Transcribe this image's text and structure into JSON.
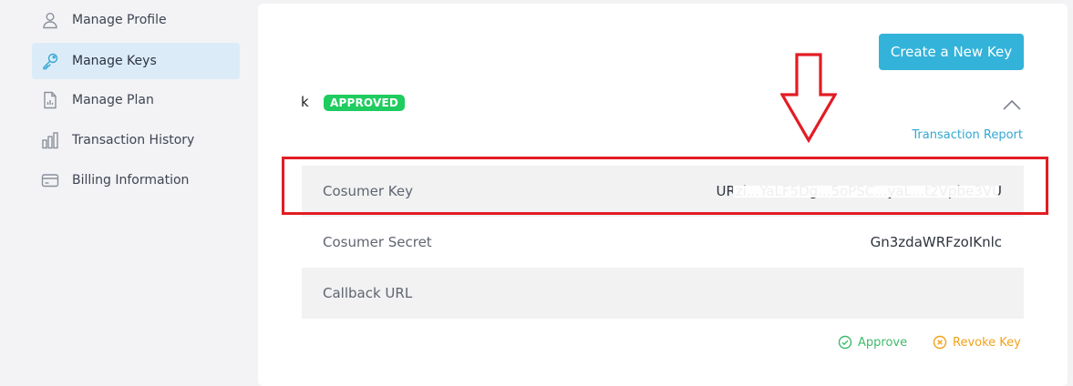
{
  "sidebar": {
    "items": [
      {
        "label": "Manage Profile",
        "icon": "user-icon"
      },
      {
        "label": "Manage Keys",
        "icon": "key-icon",
        "active": true
      },
      {
        "label": "Manage Plan",
        "icon": "document-chart-icon"
      },
      {
        "label": "Transaction History",
        "icon": "bar-chart-icon"
      },
      {
        "label": "Billing Information",
        "icon": "credit-card-icon"
      }
    ]
  },
  "main": {
    "create_button": "Create a New Key",
    "key": {
      "name": "k",
      "status": "APPROVED",
      "transaction_report": "Transaction Report",
      "rows": [
        {
          "label": "Cosumer Key",
          "value": "URzi...YaLF5Dg...5oPSC...yaL...t2Vpbe3VU"
        },
        {
          "label": "Cosumer Secret",
          "value": "Gn3zdaWRFzoIKnlc"
        },
        {
          "label": "Callback URL",
          "value": ""
        }
      ],
      "approve_label": "Approve",
      "revoke_label": "Revoke Key"
    }
  },
  "colors": {
    "accent": "#33b3d9",
    "approved": "#1fcc5f",
    "annotation": "#e21c24",
    "revoke": "#f0a21a",
    "approve": "#3fba6c"
  }
}
